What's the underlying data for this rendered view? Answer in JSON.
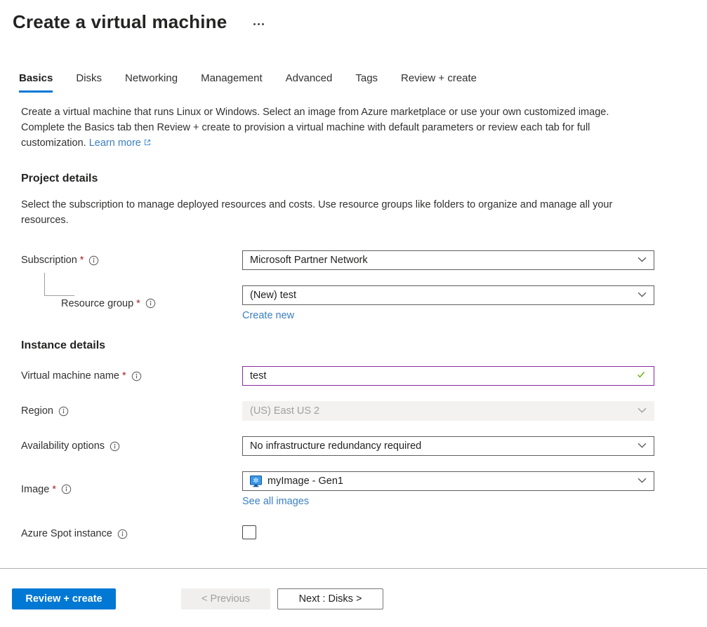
{
  "ui": {
    "required_marker": "*"
  },
  "header": {
    "title": "Create a virtual machine"
  },
  "tabs": [
    {
      "label": "Basics",
      "active": true
    },
    {
      "label": "Disks",
      "active": false
    },
    {
      "label": "Networking",
      "active": false
    },
    {
      "label": "Management",
      "active": false
    },
    {
      "label": "Advanced",
      "active": false
    },
    {
      "label": "Tags",
      "active": false
    },
    {
      "label": "Review + create",
      "active": false
    }
  ],
  "intro": {
    "text": "Create a virtual machine that runs Linux or Windows. Select an image from Azure marketplace or use your own customized image. Complete the Basics tab then Review + create to provision a virtual machine with default parameters or review each tab for full customization.",
    "learn_more": "Learn more"
  },
  "project": {
    "heading": "Project details",
    "description": "Select the subscription to manage deployed resources and costs. Use resource groups like folders to organize and manage all your resources.",
    "subscription": {
      "label": "Subscription",
      "required": true,
      "value": "Microsoft Partner Network"
    },
    "resource_group": {
      "label": "Resource group",
      "required": true,
      "value": "(New) test",
      "create_new": "Create new"
    }
  },
  "instance": {
    "heading": "Instance details",
    "vm_name": {
      "label": "Virtual machine name",
      "required": true,
      "value": "test",
      "valid": true
    },
    "region": {
      "label": "Region",
      "value": "(US) East US 2",
      "disabled": true
    },
    "availability": {
      "label": "Availability options",
      "value": "No infrastructure redundancy required"
    },
    "image": {
      "label": "Image",
      "required": true,
      "value": "myImage - Gen1",
      "see_all": "See all images"
    },
    "spot": {
      "label": "Azure Spot instance",
      "checked": false
    }
  },
  "footer": {
    "review_create": "Review + create",
    "previous": "< Previous",
    "next": "Next : Disks >"
  },
  "colors": {
    "accent_blue": "#0078d4",
    "link_blue": "#3a7fc2",
    "modified_field_purple": "#8a2da2",
    "valid_green": "#5db300",
    "required_red": "#a4262c",
    "disabled_bg": "#f3f2f1",
    "disabled_text": "#a19f9d"
  }
}
